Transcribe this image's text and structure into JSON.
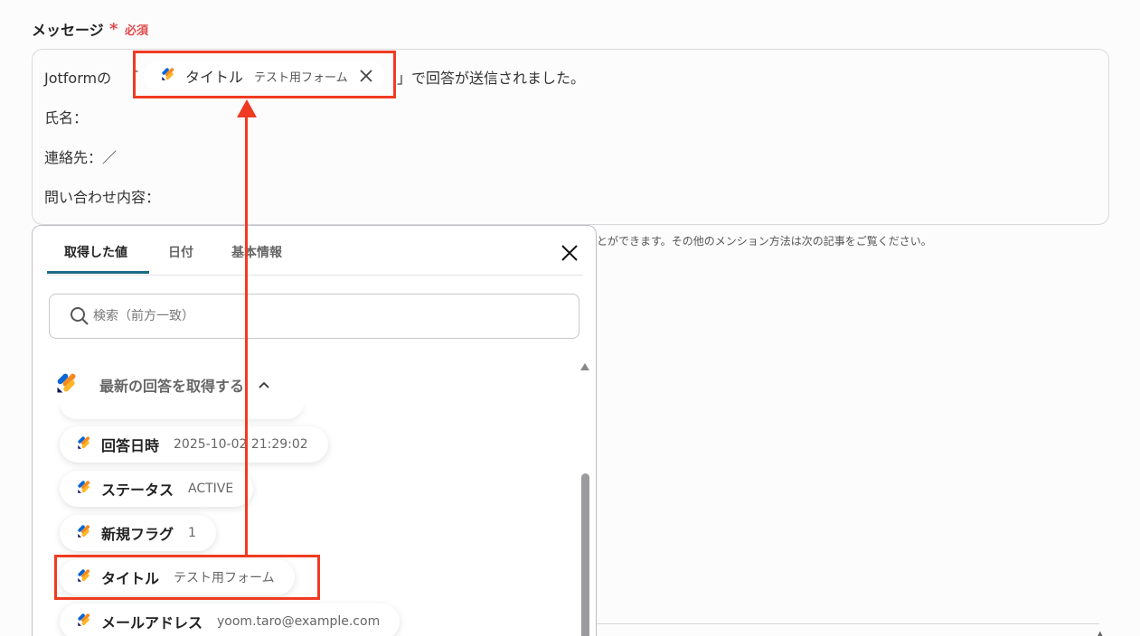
{
  "field": {
    "label": "メッセージ",
    "required_star": "*",
    "required_text": "必須"
  },
  "message": {
    "line1_prefix": "Jotformの",
    "bracket_open": "「",
    "line1_suffix": "」で回答が送信されました。",
    "line2": "氏名：",
    "line3": "連絡先：／",
    "line4": "問い合わせ内容："
  },
  "inserted_pill": {
    "label": "タイトル",
    "value": "テスト用フォーム",
    "icon": "jotform-icon",
    "remove_icon": "close-icon"
  },
  "helper_text": "とができます。その他のメンション方法は次の記事をご覧ください。",
  "panel": {
    "tabs": [
      {
        "label": "取得した値",
        "active": true
      },
      {
        "label": "日付",
        "active": false
      },
      {
        "label": "基本情報",
        "active": false
      }
    ],
    "search": {
      "placeholder": "検索（前方一致）",
      "value": ""
    },
    "group": {
      "title": "最新の回答を取得する",
      "expanded": true
    },
    "items": [
      {
        "label": "回答日時",
        "value": "2025-10-02 21:29:02"
      },
      {
        "label": "ステータス",
        "value": "ACTIVE"
      },
      {
        "label": "新規フラグ",
        "value": "1"
      },
      {
        "label": "タイトル",
        "value": "テスト用フォーム"
      },
      {
        "label": "メールアドレス",
        "value": "yoom.taro@example.com"
      }
    ]
  },
  "colors": {
    "highlight": "#ef3b22",
    "tab_underline": "#1d6a86",
    "required": "#e04b4b"
  }
}
